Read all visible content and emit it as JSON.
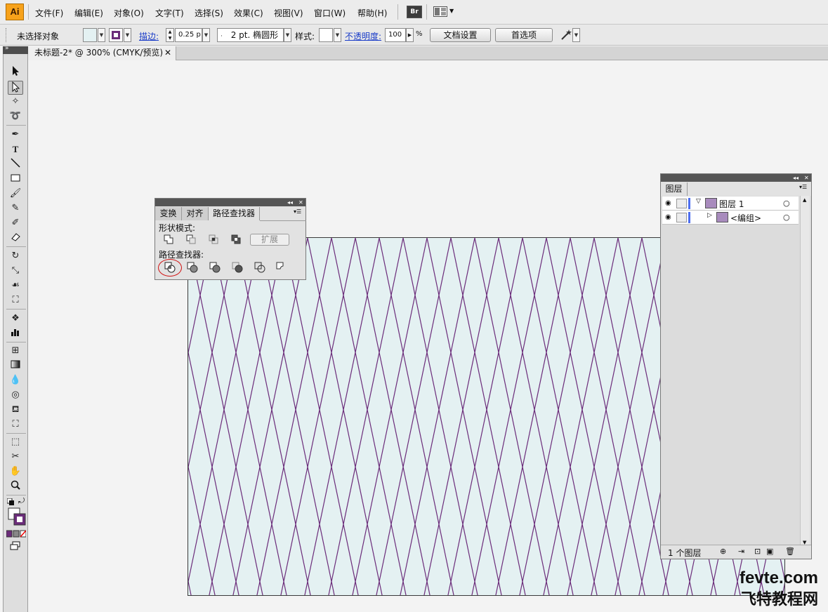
{
  "app": {
    "logo": "Ai"
  },
  "menubar": {
    "items": [
      {
        "label": "文件(F)"
      },
      {
        "label": "编辑(E)"
      },
      {
        "label": "对象(O)"
      },
      {
        "label": "文字(T)"
      },
      {
        "label": "选择(S)"
      },
      {
        "label": "效果(C)"
      },
      {
        "label": "视图(V)"
      },
      {
        "label": "窗口(W)"
      },
      {
        "label": "帮助(H)"
      }
    ],
    "bridge_button": "Br"
  },
  "control_bar": {
    "selection_status": "未选择对象",
    "stroke_label": "描边:",
    "stroke_weight": "0.25 p",
    "brush_value": "2 pt. 椭圆形",
    "style_label": "样式:",
    "opacity_label": "不透明度:",
    "opacity_value": "100",
    "opacity_unit": "%",
    "document_setup_button": "文档设置",
    "preferences_button": "首选项",
    "fill_color": "#e4f1f2",
    "stroke_color": "#6b2c7a"
  },
  "document": {
    "tab_title": "未标题-2* @ 300% (CMYK/预览)",
    "artboard_fill": "#e4f1f2",
    "pattern_line_color": "#6b2c7a"
  },
  "pathfinder_panel": {
    "tabs": [
      "变换",
      "对齐",
      "路径查找器"
    ],
    "active_tab": "路径查找器",
    "shape_modes_label": "形状模式:",
    "expand_button": "扩展",
    "pathfinders_label": "路径查找器:"
  },
  "layers_panel": {
    "tab": "图层",
    "layers": [
      {
        "name": "图层 1"
      },
      {
        "name": "<编组>"
      }
    ],
    "footer_count": "1 个图层"
  },
  "watermark": {
    "line1": "fevte.com",
    "line2": "飞特教程网"
  }
}
